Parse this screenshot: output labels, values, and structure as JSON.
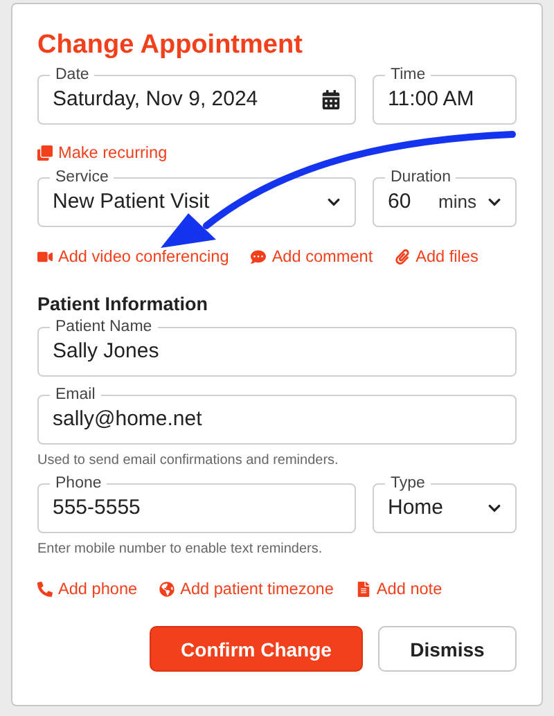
{
  "title": "Change Appointment",
  "appointment_rows": [
    [
      {
        "label": "Date",
        "value": "Saturday, Nov 9, 2024",
        "kind": "date"
      },
      {
        "label": "Time",
        "value": "11:00 AM",
        "kind": "text"
      }
    ],
    [
      {
        "label": "Service",
        "value": "New Patient Visit",
        "kind": "select"
      },
      {
        "label": "Duration",
        "value": "60",
        "unit": "mins",
        "kind": "select"
      }
    ]
  ],
  "recurring_link": {
    "label": "Make recurring",
    "kind": "recurring"
  },
  "appointment_links": [
    {
      "label": "Add video conferencing",
      "kind": "video"
    },
    {
      "label": "Add comment",
      "kind": "comment"
    },
    {
      "label": "Add files",
      "kind": "files"
    }
  ],
  "patient_section": {
    "heading": "Patient Information",
    "rows": [
      {
        "fields": [
          {
            "label": "Patient Name",
            "value": "Sally Jones",
            "kind": "text"
          }
        ]
      },
      {
        "fields": [
          {
            "label": "Email",
            "value": "sally@home.net",
            "kind": "text"
          }
        ],
        "help": "Used to send email confirmations and reminders."
      },
      {
        "fields": [
          {
            "label": "Phone",
            "value": "555-5555",
            "kind": "text"
          },
          {
            "label": "Type",
            "value": "Home",
            "kind": "select"
          }
        ],
        "help": "Enter mobile number to enable text reminders."
      }
    ],
    "links": [
      {
        "label": "Add phone",
        "kind": "phone"
      },
      {
        "label": "Add patient timezone",
        "kind": "timezone"
      },
      {
        "label": "Add note",
        "kind": "note"
      }
    ]
  },
  "buttons": [
    {
      "label": "Confirm Change",
      "kind": "primary"
    },
    {
      "label": "Dismiss",
      "kind": "secondary"
    }
  ]
}
